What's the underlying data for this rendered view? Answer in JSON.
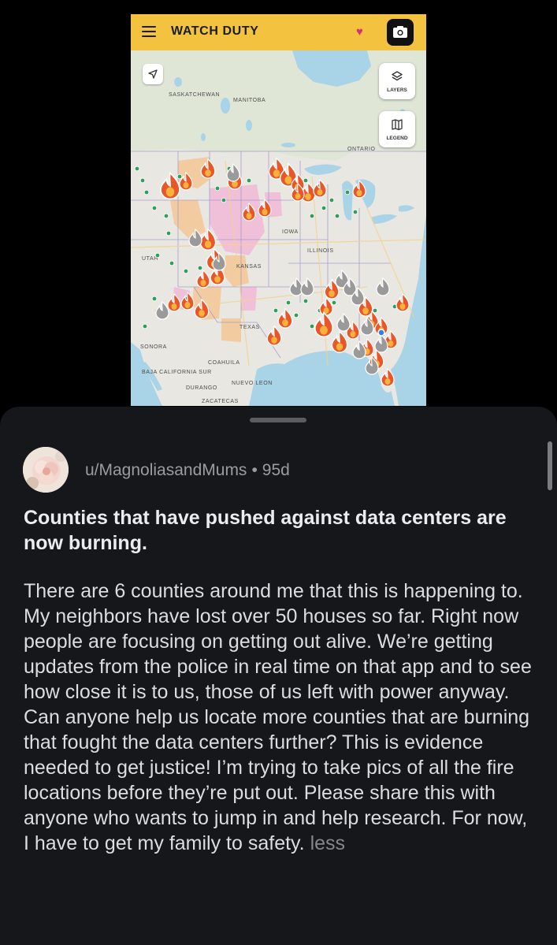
{
  "app": {
    "title": "WATCH DUTY",
    "layers_label": "LAYERS",
    "legend_label": "LEGEND",
    "map_labels": [
      "SASKATCHEWAN",
      "MANITOBA",
      "ONTARIO",
      "IOWA",
      "ILLINOIS",
      "UTAH",
      "KANSAS",
      "TEXAS",
      "SONORA",
      "COAHUILA",
      "BAJA CALIFORNIA SUR",
      "DURANGO",
      "NUEVO LEON",
      "ZACATECAS"
    ],
    "colors": {
      "header": "#f3c33f",
      "fire": "#e8562a",
      "fire_core": "#f6b23a",
      "inactive_fire": "#9a9a9a",
      "green_marker": "#2f9e5b"
    }
  },
  "post": {
    "author": "u/MagnoliasandMums",
    "age": "95d",
    "title": "Counties that have pushed against data centers are now burning.",
    "body": "There are 6 counties around me that this is happening to. My neighbors have lost over 50 houses so far. Right now people are focusing on getting out alive. We’re getting updates from the police in real time on that app and to see how close it is to us, those of us left with power anyway. Can anyone help us locate more counties that are burning that fought the data centers further? This is evidence needed to get justice! I’m trying to take pics of all the fire locations before they’re put out. Please share this with anyone who wants to jump in and help research. For now, I have to get my family to safety.",
    "less_label": "less"
  }
}
